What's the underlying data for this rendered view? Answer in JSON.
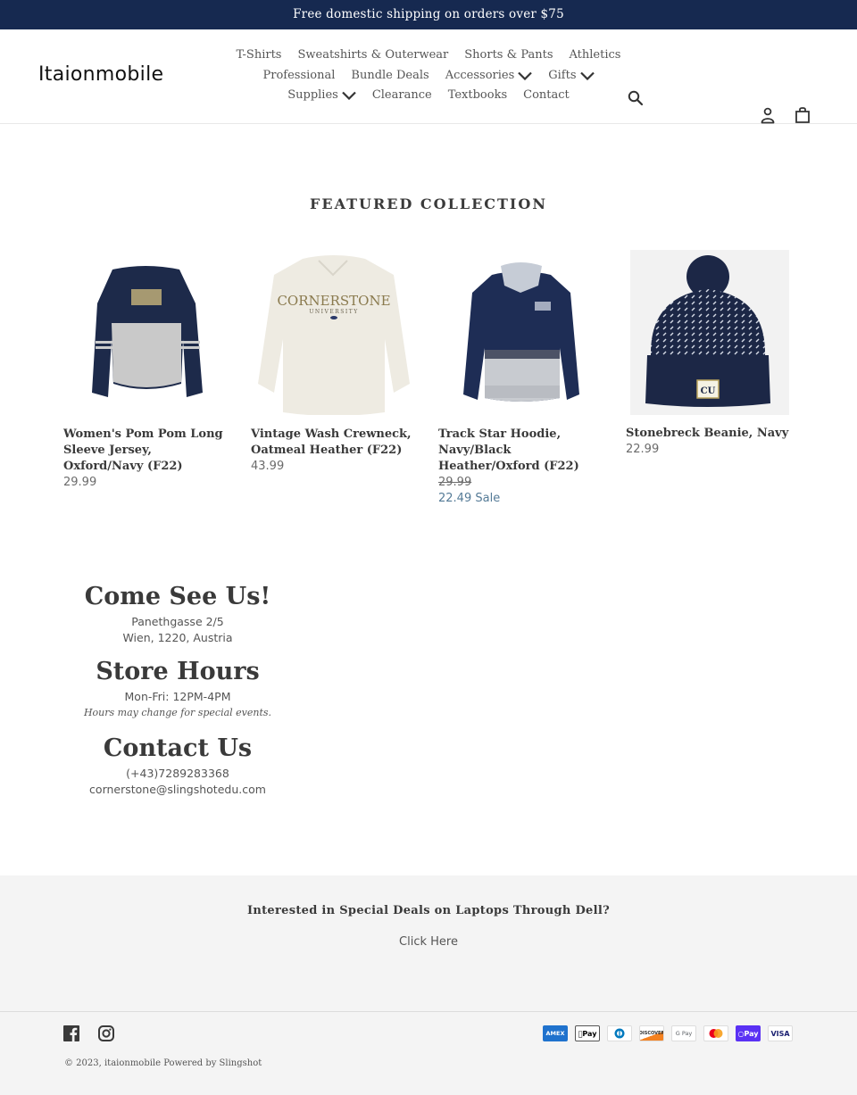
{
  "announcement": "Free domestic shipping on orders over $75",
  "header": {
    "logo": "Itaionmobile",
    "nav_rows": [
      [
        {
          "label": "T-Shirts",
          "dropdown": false
        },
        {
          "label": "Sweatshirts & Outerwear",
          "dropdown": false
        },
        {
          "label": "Shorts & Pants",
          "dropdown": false
        },
        {
          "label": "Athletics",
          "dropdown": false
        }
      ],
      [
        {
          "label": "Professional",
          "dropdown": false
        },
        {
          "label": "Bundle Deals",
          "dropdown": false
        },
        {
          "label": "Accessories",
          "dropdown": true
        },
        {
          "label": "Gifts",
          "dropdown": true
        }
      ],
      [
        {
          "label": "Supplies",
          "dropdown": true
        },
        {
          "label": "Clearance",
          "dropdown": false
        },
        {
          "label": "Textbooks",
          "dropdown": false
        },
        {
          "label": "Contact",
          "dropdown": false
        }
      ]
    ],
    "icons": {
      "search": "search-icon",
      "account": "user-icon",
      "cart": "shopping-bag-icon"
    }
  },
  "featured": {
    "title": "FEATURED COLLECTION",
    "products": [
      {
        "name": "Women's Pom Pom Long Sleeve Jersey, Oxford/Navy (F22)",
        "price": "29.99",
        "image": "navy-gray-jersey"
      },
      {
        "name": "Vintage Wash Crewneck, Oatmeal Heather (F22)",
        "price": "43.99",
        "image": "oatmeal-crewneck",
        "graphic_text": "CORNERSTONE",
        "graphic_subtext": "UNIVERSITY"
      },
      {
        "name": "Track Star Hoodie, Navy/Black Heather/Oxford (F22)",
        "original_price": "29.99",
        "sale_price": "22.49",
        "sale_label": "Sale",
        "image": "navy-gray-hoodie"
      },
      {
        "name": "Stonebreck Beanie, Navy",
        "price": "22.99",
        "image": "navy-beanie",
        "patch_text": "CU"
      }
    ]
  },
  "info": {
    "visit_heading": "Come See Us!",
    "address_line1": "Panethgasse 2/5",
    "address_line2": "Wien, 1220, Austria",
    "hours_heading": "Store Hours",
    "hours": "Mon-Fri: 12PM-4PM",
    "hours_note": "Hours may change for special events.",
    "contact_heading": "Contact Us",
    "phone": "(+43)7289283368",
    "email": "cornerstone@slingshotedu.com"
  },
  "promo": {
    "title": "Interested in Special Deals on Laptops Through Dell?",
    "link": "Click Here"
  },
  "footer": {
    "social": [
      "facebook-icon",
      "instagram-icon"
    ],
    "copyright": "© 2023, itaionmobile Powered by Slingshot",
    "payments": [
      {
        "name": "American Express",
        "label": "AMEX",
        "color": "#1f72cd"
      },
      {
        "name": "Apple Pay",
        "label": "Pay",
        "color": "#000000"
      },
      {
        "name": "Diners Club",
        "label": "",
        "color": "#0079be"
      },
      {
        "name": "Discover",
        "label": "DISCOVER",
        "color": "#f48120"
      },
      {
        "name": "Google Pay",
        "label": "G Pay",
        "color": "#5f6368"
      },
      {
        "name": "Mastercard",
        "label": "",
        "color": "#eb001b"
      },
      {
        "name": "Shop Pay",
        "label": "Pay",
        "color": "#5a31f4"
      },
      {
        "name": "Visa",
        "label": "VISA",
        "color": "#1a1f71"
      }
    ]
  }
}
